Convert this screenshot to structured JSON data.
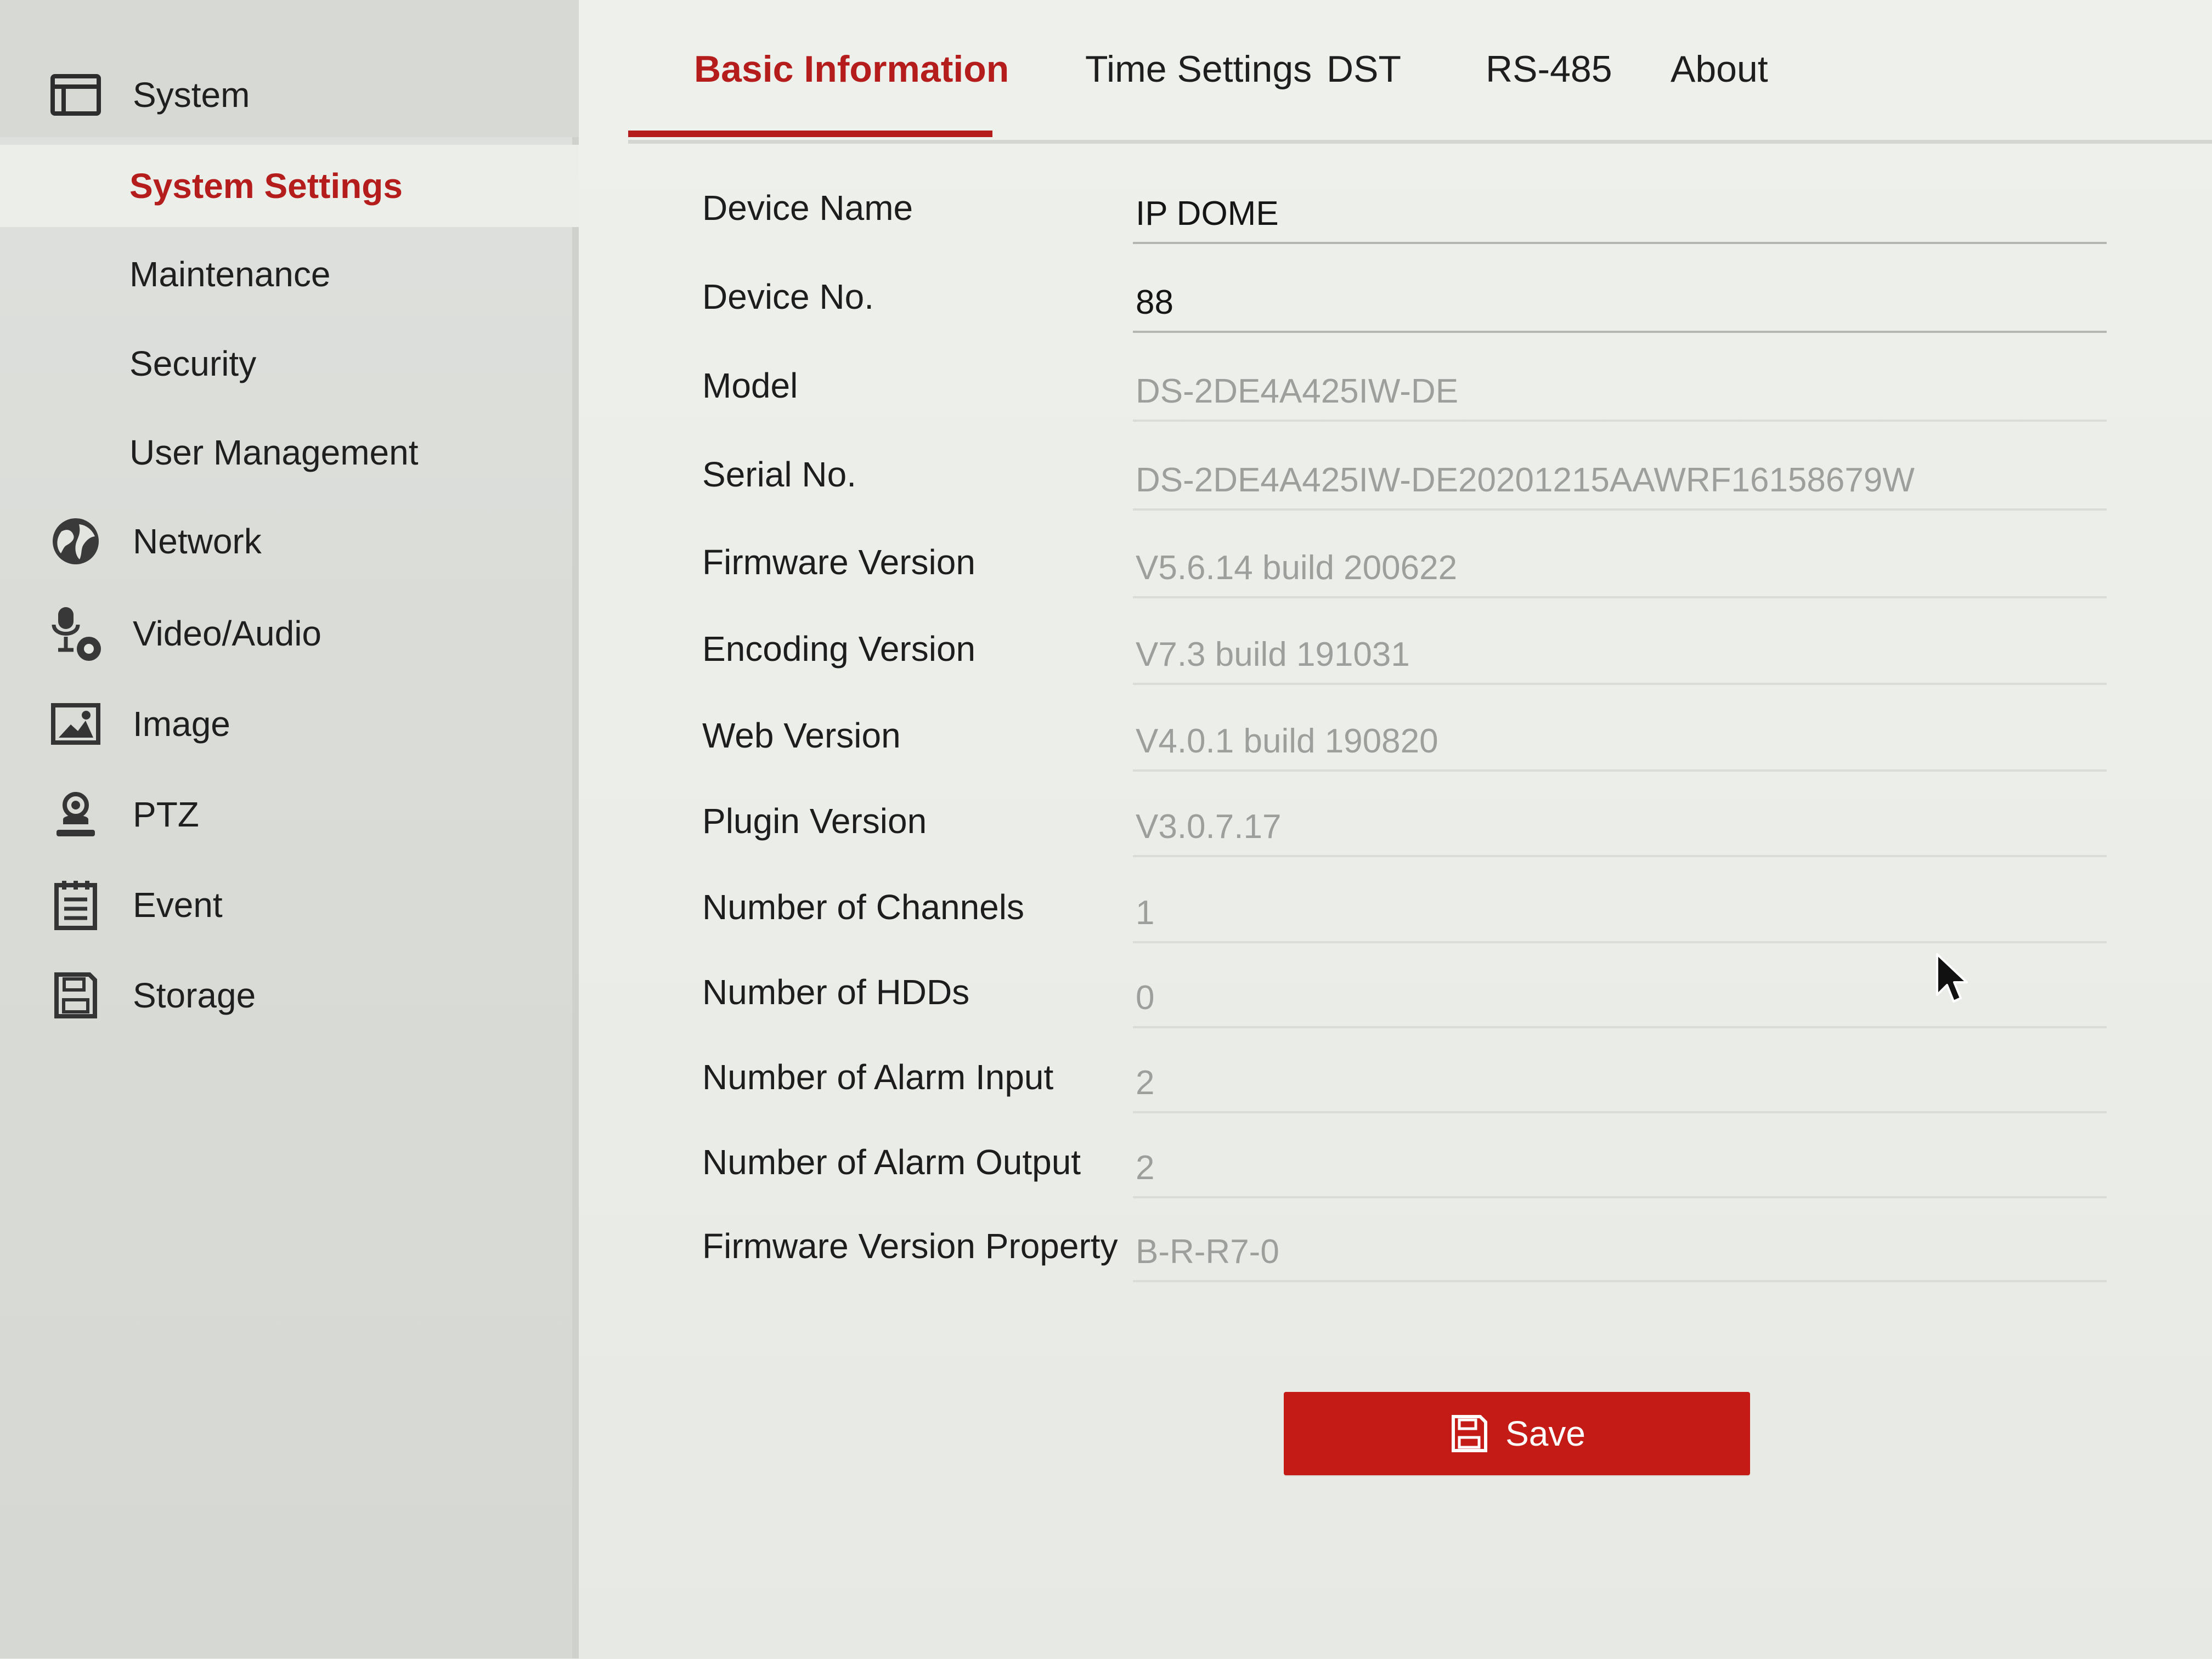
{
  "sidebar": {
    "system": {
      "label": "System",
      "icon": "system-window-icon",
      "submenu": [
        {
          "label": "System Settings",
          "active": true
        },
        {
          "label": "Maintenance",
          "active": false
        },
        {
          "label": "Security",
          "active": false
        },
        {
          "label": "User Management",
          "active": false
        }
      ]
    },
    "items": [
      {
        "label": "Network",
        "icon": "globe-icon"
      },
      {
        "label": "Video/Audio",
        "icon": "microphone-camera-icon"
      },
      {
        "label": "Image",
        "icon": "image-icon"
      },
      {
        "label": "PTZ",
        "icon": "ptz-camera-icon"
      },
      {
        "label": "Event",
        "icon": "calendar-list-icon"
      },
      {
        "label": "Storage",
        "icon": "save-disk-icon"
      }
    ]
  },
  "tabs": [
    {
      "label": "Basic Information",
      "active": true
    },
    {
      "label": "Time Settings",
      "active": false
    },
    {
      "label": "DST",
      "active": false
    },
    {
      "label": "RS-485",
      "active": false
    },
    {
      "label": "About",
      "active": false
    }
  ],
  "form": {
    "rows": [
      {
        "label": "Device Name",
        "value": "IP DOME",
        "editable": true
      },
      {
        "label": "Device No.",
        "value": "88",
        "editable": true
      },
      {
        "label": "Model",
        "value": "DS-2DE4A425IW-DE",
        "editable": false
      },
      {
        "label": "Serial No.",
        "value": "DS-2DE4A425IW-DE20201215AAWRF16158679W",
        "editable": false
      },
      {
        "label": "Firmware Version",
        "value": "V5.6.14 build 200622",
        "editable": false
      },
      {
        "label": "Encoding Version",
        "value": "V7.3 build 191031",
        "editable": false
      },
      {
        "label": "Web Version",
        "value": "V4.0.1 build 190820",
        "editable": false
      },
      {
        "label": "Plugin Version",
        "value": "V3.0.7.17",
        "editable": false
      },
      {
        "label": "Number of Channels",
        "value": "1",
        "editable": false
      },
      {
        "label": "Number of HDDs",
        "value": "0",
        "editable": false
      },
      {
        "label": "Number of Alarm Input",
        "value": "2",
        "editable": false
      },
      {
        "label": "Number of Alarm Output",
        "value": "2",
        "editable": false
      },
      {
        "label": "Firmware Version Property",
        "value": "B-R-R7-0",
        "editable": false
      }
    ],
    "save_label": "Save"
  },
  "colors": {
    "accent": "#b51d1d",
    "button": "#c51b17",
    "readonly_text": "#9c9f9b"
  }
}
